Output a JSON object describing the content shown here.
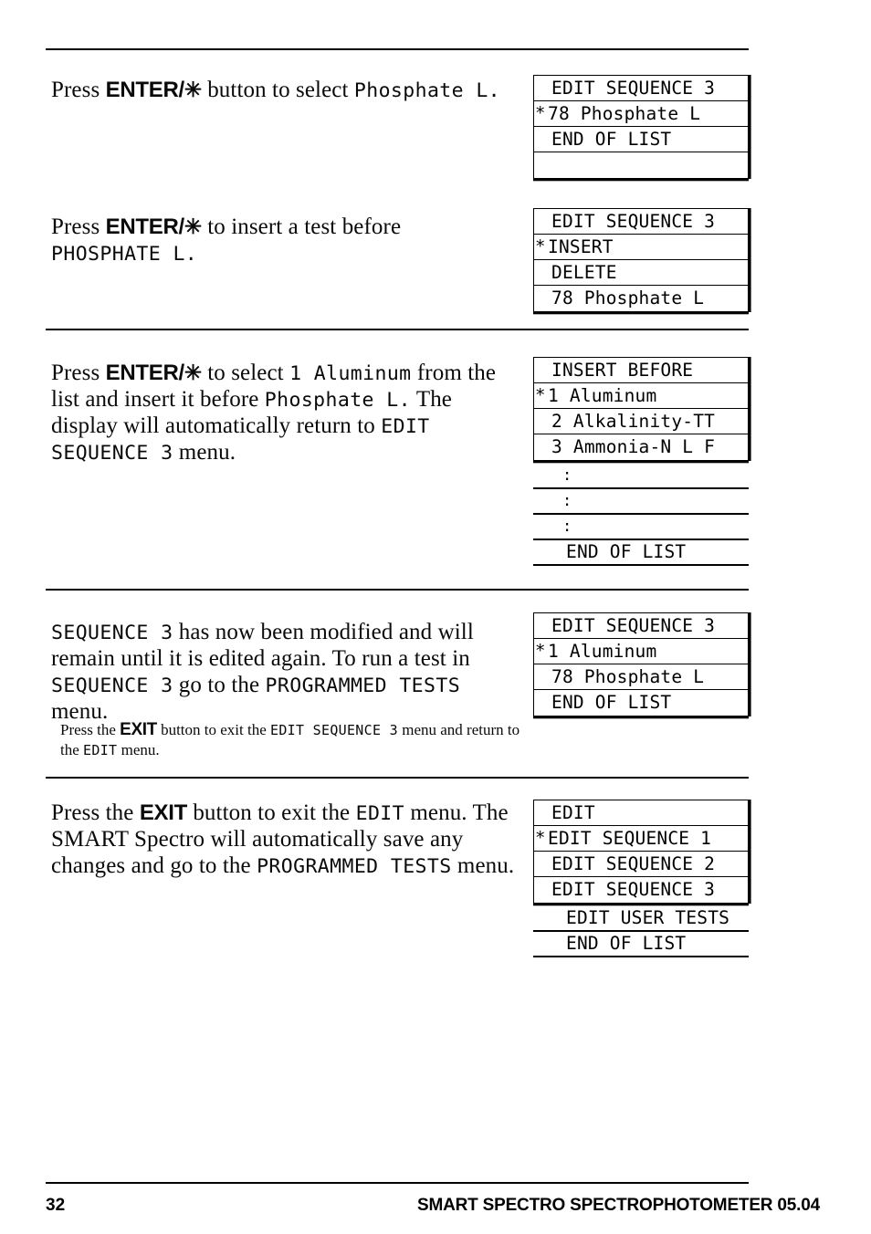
{
  "page": {
    "number": "32",
    "footer_title": "SMART SPECTRO SPECTROPHOTOMETER  05.04"
  },
  "sections": [
    {
      "id": "select-phosphate",
      "paragraph": {
        "press": "Press ",
        "key": "ENTER",
        "key_sep": "/",
        "key_star": "✳",
        "rest_1": " button to select ",
        "lcd_1": "Phosphate L."
      },
      "display": {
        "rows": [
          {
            "star": "",
            "label": "EDIT SEQUENCE 3",
            "indent": true
          },
          {
            "star": "*",
            "label": "78 Phosphate L",
            "indent": false
          },
          {
            "star": "",
            "label": "END OF LIST",
            "indent": true
          },
          {
            "star": "",
            "label": "",
            "indent": true
          }
        ],
        "continuation": []
      }
    },
    {
      "id": "insert-test",
      "paragraph": {
        "press": "Press ",
        "key": "ENTER",
        "key_sep": "/",
        "key_star": "✳",
        "rest_1": " to insert a test before",
        "lcd_1": "PHOSPHATE L."
      },
      "display": {
        "rows": [
          {
            "star": "",
            "label": "EDIT SEQUENCE 3",
            "indent": true
          },
          {
            "star": "*",
            "label": "INSERT",
            "indent": false
          },
          {
            "star": "",
            "label": "DELETE",
            "indent": true
          },
          {
            "star": "",
            "label": "78 Phosphate L",
            "indent": true
          }
        ],
        "continuation": []
      }
    },
    {
      "id": "select-aluminum",
      "paragraph": {
        "press": "Press ",
        "key": "ENTER",
        "key_sep": "/",
        "key_star": "✳",
        "rest_1": " to select ",
        "lcd_1": "1 Aluminum",
        "rest_2": " from the list and insert it before ",
        "lcd_2": "Phosphate L.",
        "rest_3": " The display will automatically return to ",
        "lcd_3": "EDIT SEQUENCE 3",
        "rest_4": " menu."
      },
      "display": {
        "rows": [
          {
            "star": "",
            "label": "INSERT BEFORE",
            "indent": true
          },
          {
            "star": "*",
            "label": "1 Aluminum",
            "indent": false
          },
          {
            "star": "",
            "label": "2 Alkalinity-TT",
            "indent": true
          },
          {
            "star": "",
            "label": "3 Ammonia-N L F",
            "indent": true
          }
        ],
        "continuation": [
          {
            "dots": ":",
            "label": ""
          },
          {
            "dots": ":",
            "label": ""
          },
          {
            "dots": ":",
            "label": ""
          },
          {
            "dots": "",
            "label": "END OF LIST"
          }
        ]
      }
    },
    {
      "id": "sequence-modified",
      "paragraph": {
        "lcd_1": "SEQUENCE 3",
        "rest_1": " has now been modified and will remain until it is edited again. To run a test in ",
        "lcd_2": "SEQUENCE 3",
        "rest_2": " go to the ",
        "lcd_3": "PROGRAMMED TESTS",
        "rest_3": " menu."
      },
      "note": {
        "press": "Press the ",
        "key": "EXIT",
        "rest_1": " button to exit the ",
        "lcd_1": "EDIT SEQUENCE 3",
        "rest_2": " menu and return to the ",
        "lcd_2": "EDIT",
        "rest_3": " menu."
      },
      "display": {
        "rows": [
          {
            "star": "",
            "label": "EDIT SEQUENCE 3",
            "indent": true
          },
          {
            "star": "*",
            "label": "1 Aluminum",
            "indent": false
          },
          {
            "star": "",
            "label": "78 Phosphate L",
            "indent": true
          },
          {
            "star": "",
            "label": "END OF LIST",
            "indent": true
          }
        ],
        "continuation": []
      }
    },
    {
      "id": "exit-edit",
      "paragraph": {
        "press": "Press the ",
        "key": "EXIT",
        "rest_1": " button to exit the ",
        "lcd_1": "EDIT",
        "rest_2": " menu. The SMART Spectro will automatically save any changes and go to the ",
        "lcd_2": "PROGRAMMED TESTS",
        "rest_3": " menu."
      },
      "display": {
        "rows": [
          {
            "star": "",
            "label": "EDIT",
            "indent": true
          },
          {
            "star": "*",
            "label": "EDIT SEQUENCE 1",
            "indent": false
          },
          {
            "star": "",
            "label": "EDIT SEQUENCE 2",
            "indent": true
          },
          {
            "star": "",
            "label": "EDIT SEQUENCE 3",
            "indent": true
          }
        ],
        "continuation": [
          {
            "dots": "",
            "label": "EDIT USER TESTS"
          },
          {
            "dots": "",
            "label": "END OF LIST"
          }
        ]
      }
    }
  ]
}
